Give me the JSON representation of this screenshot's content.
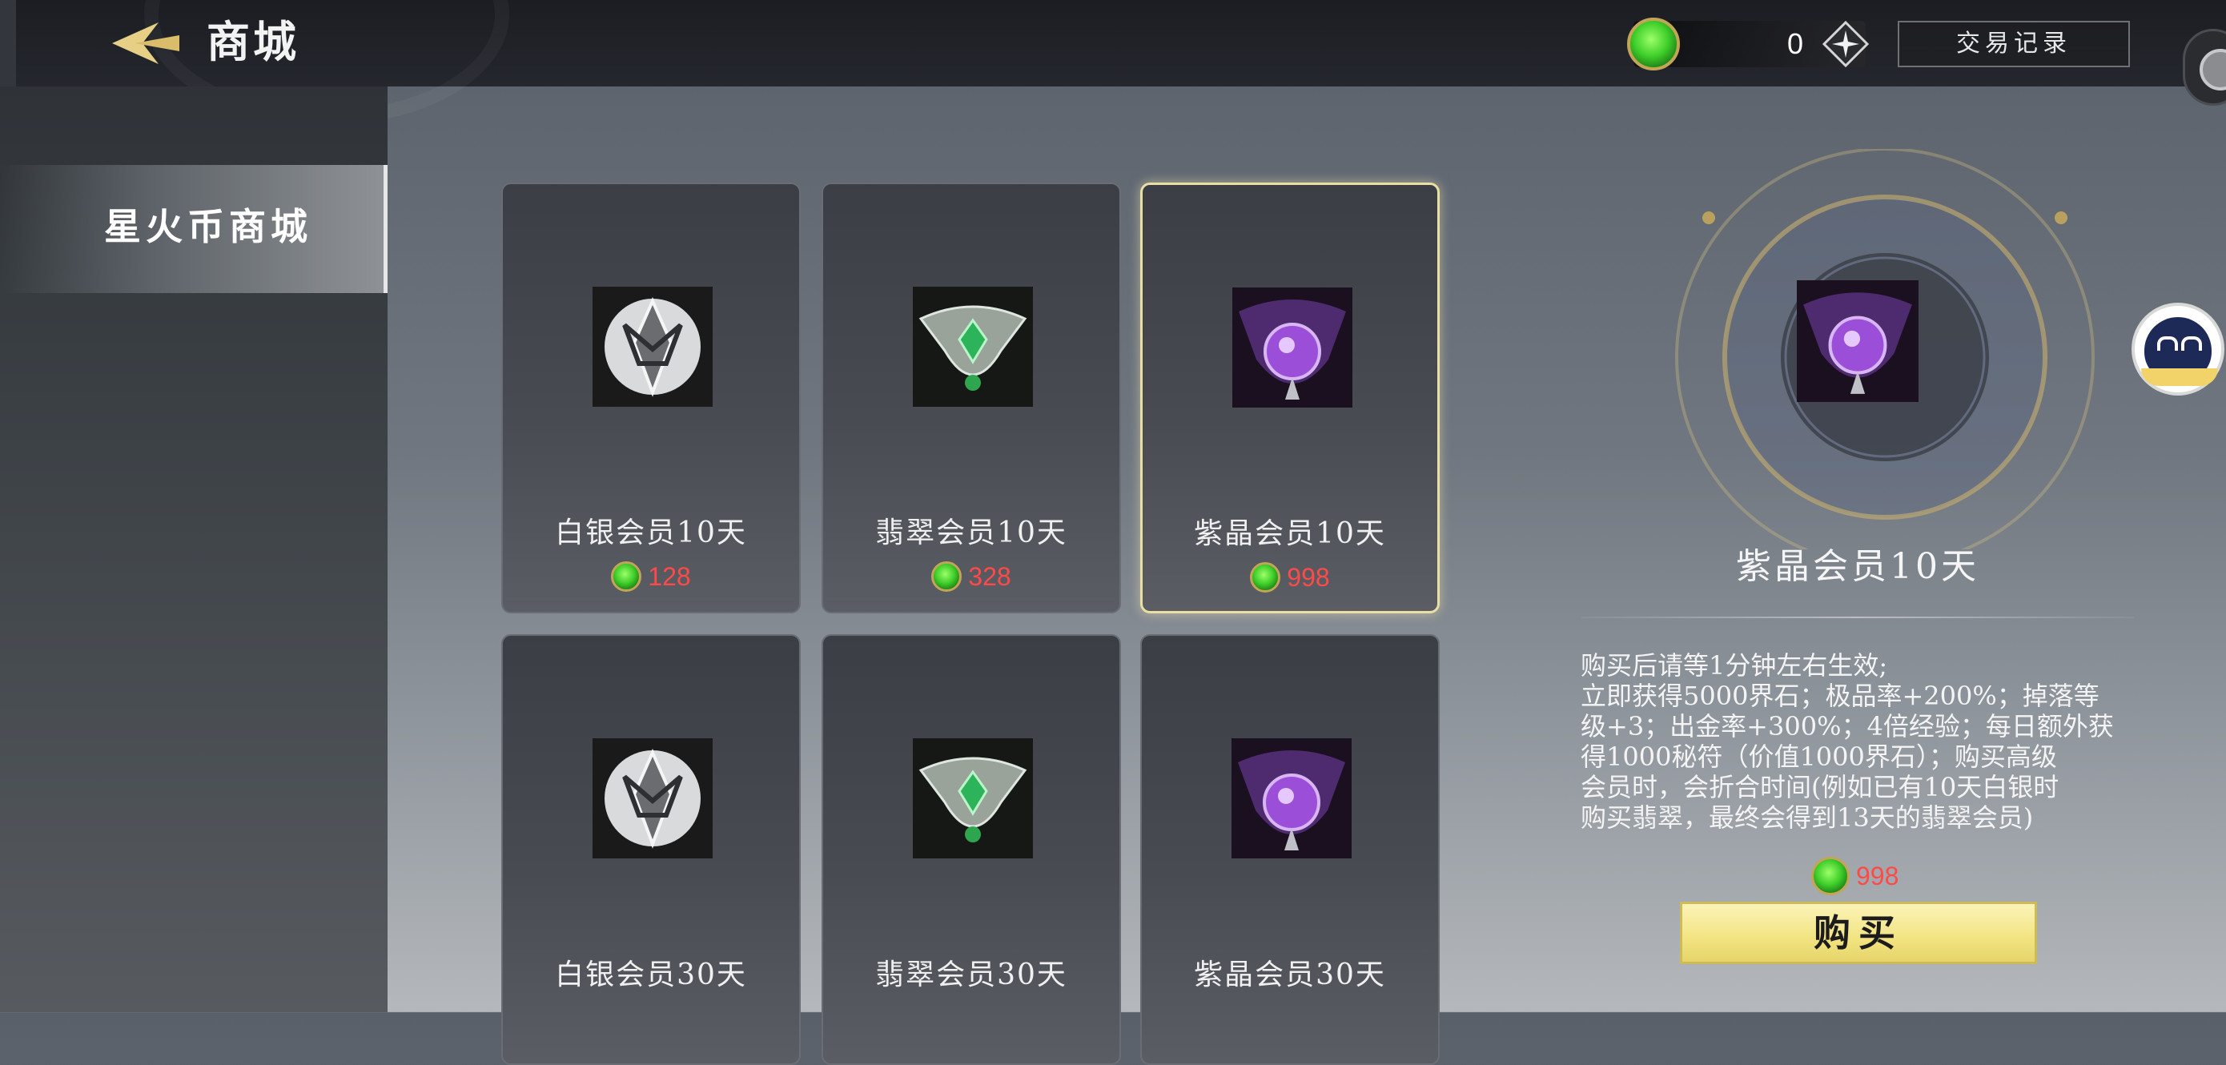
{
  "header": {
    "title": "商城",
    "currency_value": "0",
    "history_label": "交易记录"
  },
  "sidebar": {
    "items": [
      {
        "label": "星火币商城",
        "selected": true
      }
    ]
  },
  "shop": {
    "items": [
      {
        "name": "白银会员10天",
        "price": "128",
        "tier": "silver"
      },
      {
        "name": "翡翠会员10天",
        "price": "328",
        "tier": "emerald"
      },
      {
        "name": "紫晶会员10天",
        "price": "998",
        "tier": "amethyst",
        "selected": true
      },
      {
        "name": "白银会员30天",
        "price": "",
        "tier": "silver"
      },
      {
        "name": "翡翠会员30天",
        "price": "",
        "tier": "emerald"
      },
      {
        "name": "紫晶会员30天",
        "price": "",
        "tier": "amethyst"
      }
    ]
  },
  "detail": {
    "name": "紫晶会员10天",
    "description": "购买后请等1分钟左右生效;\n立即获得5000界石；极品率+200%；掉落等\n级+3；出金率+300%；4倍经验；每日额外获\n得1000秘符（价值1000界石）；购买高级\n会员时，会折合时间(例如已有10天白银时\n购买翡翠，最终会得到13天的翡翠会员)",
    "price": "998",
    "buy_label": "购买"
  },
  "colors": {
    "price_red": "#ff4a4a",
    "coin_green": "#3fcf2a",
    "buy_yellow": "#f2e481",
    "selected_border": "#e9dfa5"
  },
  "icons": {
    "back": "back-arrow-icon",
    "coin": "jade-coin-icon",
    "add": "add-currency-icon",
    "helper": "customer-service-icon"
  }
}
